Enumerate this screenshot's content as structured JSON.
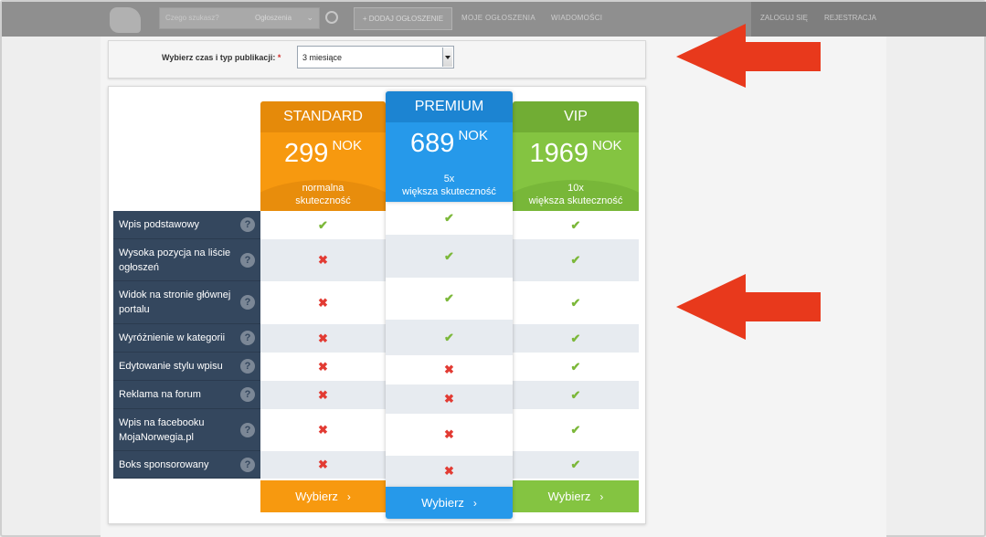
{
  "topbar": {
    "search_placeholder": "Czego szukasz?",
    "search_select": "Ogłoszenia",
    "add_button": "+ DODAJ OGŁOSZENIE",
    "nav": [
      "MOJE OGŁOSZENIA",
      "WIADOMOŚCI"
    ],
    "login": "ZALOGUJ SIĘ",
    "register": "REJESTRACJA"
  },
  "selector": {
    "label": "Wybierz czas i typ publikacji:",
    "required_mark": "*",
    "value": "3 miesiące"
  },
  "plans": [
    {
      "name": "STANDARD",
      "price": "299",
      "currency": "NOK",
      "desc_line1": "normalna",
      "desc_line2": "skuteczność",
      "cta": "Wybierz",
      "color": "#f7990f"
    },
    {
      "name": "PREMIUM",
      "price": "689",
      "currency": "NOK",
      "desc_line1": "5x",
      "desc_line2": "większa skuteczność",
      "cta": "Wybierz",
      "color": "#2699ea"
    },
    {
      "name": "VIP",
      "price": "1969",
      "currency": "NOK",
      "desc_line1": "10x",
      "desc_line2": "większa skuteczność",
      "cta": "Wybierz",
      "color": "#84c441"
    }
  ],
  "features": [
    {
      "label": "Wpis podstawowy",
      "standard": true,
      "premium": true,
      "vip": true
    },
    {
      "label": "Wysoka pozycja na liście ogłoszeń",
      "standard": false,
      "premium": true,
      "vip": true
    },
    {
      "label": "Widok na stronie głównej portalu",
      "standard": false,
      "premium": true,
      "vip": true
    },
    {
      "label": "Wyróżnienie w kategorii",
      "standard": false,
      "premium": true,
      "vip": true
    },
    {
      "label": "Edytowanie stylu wpisu",
      "standard": false,
      "premium": false,
      "vip": true
    },
    {
      "label": "Reklama na forum",
      "standard": false,
      "premium": false,
      "vip": true
    },
    {
      "label": "Wpis na facebooku MojaNorwegia.pl",
      "standard": false,
      "premium": false,
      "vip": true
    },
    {
      "label": "Boks sponsorowany",
      "standard": false,
      "premium": false,
      "vip": true
    }
  ],
  "symbols": {
    "check": "✔",
    "cross": "✖",
    "help": "?",
    "chevron": "›"
  },
  "colors": {
    "annotation_arrow": "#e8391c",
    "feature_bg": "#34475e"
  }
}
